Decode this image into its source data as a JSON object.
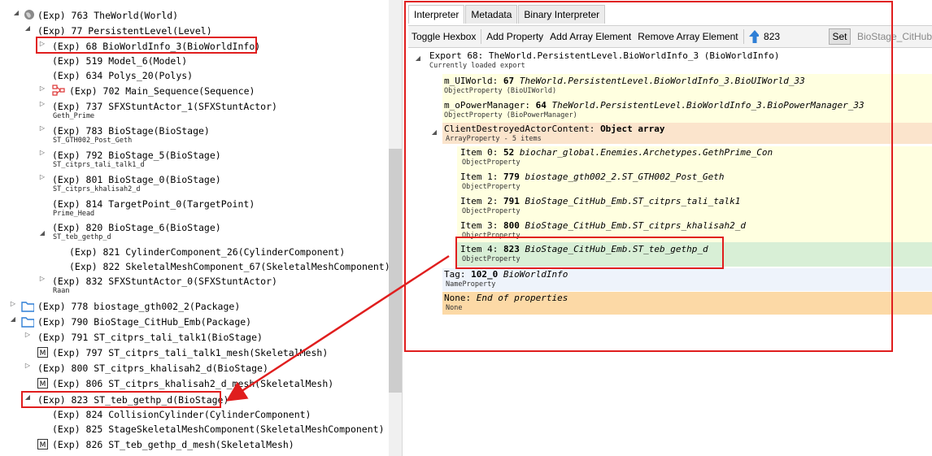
{
  "tree": {
    "rows": [
      {
        "main": "(Exp) 763 TheWorld(World)"
      },
      {
        "main": "(Exp) 77 PersistentLevel(Level)"
      },
      {
        "main": "(Exp) 68 BioWorldInfo_3(BioWorldInfo)"
      },
      {
        "main": "(Exp) 519 Model_6(Model)"
      },
      {
        "main": "(Exp) 634 Polys_20(Polys)"
      },
      {
        "main": "(Exp) 702 Main_Sequence(Sequence)"
      },
      {
        "main": "(Exp) 737 SFXStuntActor_1(SFXStuntActor)",
        "sub": "Geth_Prime"
      },
      {
        "main": "(Exp) 783 BioStage(BioStage)",
        "sub": "ST_GTH002_Post_Geth"
      },
      {
        "main": "(Exp) 792 BioStage_5(BioStage)",
        "sub": "ST_citprs_tali_talk1_d"
      },
      {
        "main": "(Exp) 801 BioStage_0(BioStage)",
        "sub": "ST_citprs_khalisah2_d"
      },
      {
        "main": "(Exp) 814 TargetPoint_0(TargetPoint)",
        "sub": "Prime_Head"
      },
      {
        "main": "(Exp) 820 BioStage_6(BioStage)",
        "sub": "ST_teb_gethp_d"
      },
      {
        "main": "(Exp) 821 CylinderComponent_26(CylinderComponent)"
      },
      {
        "main": "(Exp) 822 SkeletalMeshComponent_67(SkeletalMeshComponent)"
      },
      {
        "main": "(Exp) 832 SFXStuntActor_0(SFXStuntActor)",
        "sub": "Raan"
      },
      {
        "main": "(Exp) 778 biostage_gth002_2(Package)"
      },
      {
        "main": "(Exp) 790 BioStage_CitHub_Emb(Package)"
      },
      {
        "main": "(Exp) 791 ST_citprs_tali_talk1(BioStage)"
      },
      {
        "main": "(Exp) 797 ST_citprs_tali_talk1_mesh(SkeletalMesh)"
      },
      {
        "main": "(Exp) 800 ST_citprs_khalisah2_d(BioStage)"
      },
      {
        "main": "(Exp) 806 ST_citprs_khalisah2_d_mesh(SkeletalMesh)"
      },
      {
        "main": "(Exp) 823 ST_teb_gethp_d(BioStage)"
      },
      {
        "main": "(Exp) 824 CollisionCylinder(CylinderComponent)"
      },
      {
        "main": "(Exp) 825 StageSkeletalMeshComponent(SkeletalMeshComponent)"
      },
      {
        "main": "(Exp) 826 ST_teb_gethp_d_mesh(SkeletalMesh)"
      }
    ]
  },
  "tabs": [
    "Interpreter",
    "Metadata",
    "Binary Interpreter"
  ],
  "toolbar": {
    "toggle_hexbox": "Toggle Hexbox",
    "add_property": "Add Property",
    "add_array_element": "Add Array Element",
    "remove_array_element": "Remove Array Element",
    "search_value": "823",
    "set_label": "Set",
    "class_label": "BioStage_CitHub"
  },
  "props": {
    "export_title": "Export 68: TheWorld.PersistentLevel.BioWorldInfo_3 (BioWorldInfo)",
    "export_sub": "Currently loaded export",
    "items": [
      {
        "name": "m_UIWorld:",
        "val": "67",
        "ref": "TheWorld.PersistentLevel.BioWorldInfo_3.BioUIWorld_33",
        "sub": "ObjectProperty (BioUIWorld)"
      },
      {
        "name": "m_oPowerManager:",
        "val": "64",
        "ref": "TheWorld.PersistentLevel.BioWorldInfo_3.BioPowerManager_33",
        "sub": "ObjectProperty (BioPowerManager)"
      },
      {
        "name": "ClientDestroyedActorContent:",
        "val": "Object array",
        "ref": "",
        "sub": "ArrayProperty - 5 items"
      },
      {
        "name": "Item 0:",
        "val": "52",
        "ref": "biochar_global.Enemies.Archetypes.GethPrime_Con",
        "sub": "ObjectProperty"
      },
      {
        "name": "Item 1:",
        "val": "779",
        "ref": "biostage_gth002_2.ST_GTH002_Post_Geth",
        "sub": "ObjectProperty"
      },
      {
        "name": "Item 2:",
        "val": "791",
        "ref": "BioStage_CitHub_Emb.ST_citprs_tali_talk1",
        "sub": "ObjectProperty"
      },
      {
        "name": "Item 3:",
        "val": "800",
        "ref": "BioStage_CitHub_Emb.ST_citprs_khalisah2_d",
        "sub": "ObjectProperty"
      },
      {
        "name": "Item 4:",
        "val": "823",
        "ref": "BioStage_CitHub_Emb.ST_teb_gethp_d",
        "sub": "ObjectProperty"
      },
      {
        "name": "Tag:",
        "val": "102_0",
        "ref": "BioWorldInfo",
        "sub": "NameProperty"
      },
      {
        "name": "None:",
        "val": "",
        "ref": "End of properties",
        "sub": "None"
      }
    ]
  },
  "colors": {
    "annotation_red": "#e01e1e",
    "accent_blue": "#2f7fd6"
  }
}
